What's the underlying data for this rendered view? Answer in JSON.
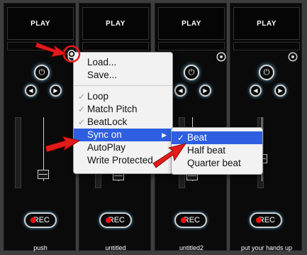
{
  "decks": [
    {
      "play_label": "PLAY",
      "rec_label": "REC",
      "name": "push"
    },
    {
      "play_label": "PLAY",
      "rec_label": "REC",
      "name": "untitled"
    },
    {
      "play_label": "PLAY",
      "rec_label": "REC",
      "name": "untitled2"
    },
    {
      "play_label": "PLAY",
      "rec_label": "REC",
      "name": "put your hands up"
    }
  ],
  "context_menu": {
    "items": [
      {
        "label": "Load...",
        "checked": false
      },
      {
        "label": "Save...",
        "checked": false
      },
      {
        "label": "Loop",
        "checked": true
      },
      {
        "label": "Match Pitch",
        "checked": true
      },
      {
        "label": "BeatLock",
        "checked": true
      },
      {
        "label": "Sync on",
        "checked": false,
        "highlighted": true,
        "submenu_arrow": "▶"
      },
      {
        "label": "AutoPlay",
        "checked": false
      },
      {
        "label": "Write Protected",
        "checked": false
      }
    ]
  },
  "sync_submenu": {
    "items": [
      {
        "label": "Beat",
        "checked": true,
        "highlighted": true
      },
      {
        "label": "Half beat",
        "checked": false
      },
      {
        "label": "Quarter beat",
        "checked": false
      }
    ]
  },
  "check_glyph": "✓",
  "icons": {
    "power": "⏻",
    "prev": "◀",
    "next": "▶"
  },
  "colors": {
    "menu_highlight": "#2e5fe0",
    "annotation_arrow": "#e21b1b",
    "rec_dot": "#e11111",
    "glow": "#6fb3d8"
  }
}
